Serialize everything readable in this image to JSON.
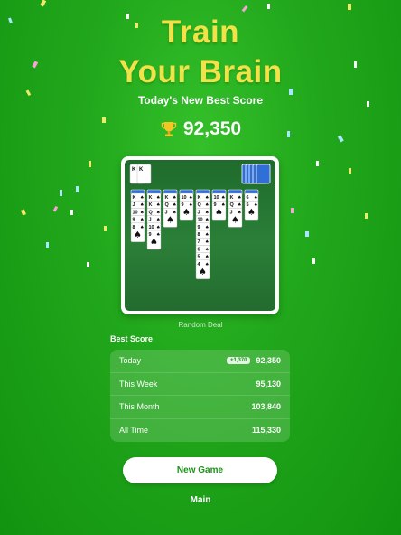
{
  "header": {
    "title_line1": "Train",
    "title_line2": "Your Brain",
    "subtitle": "Today's New Best Score",
    "score": "92,350",
    "trophy_icon": "trophy-icon"
  },
  "preview": {
    "caption": "Random Deal",
    "foundation": [
      "K",
      "K"
    ],
    "columns": [
      [
        "K",
        "J",
        "10",
        "9",
        "8"
      ],
      [
        "K",
        "K",
        "Q",
        "J",
        "10",
        "9"
      ],
      [
        "K",
        "Q",
        "J"
      ],
      [
        "10",
        "9"
      ],
      [
        "K",
        "Q",
        "J",
        "10",
        "9",
        "8",
        "7",
        "6",
        "5",
        "4"
      ],
      [
        "10",
        "9"
      ],
      [
        "K",
        "Q",
        "J"
      ],
      [
        "6",
        "5"
      ]
    ]
  },
  "best_score": {
    "label": "Best Score",
    "rows": [
      {
        "period": "Today",
        "delta": "+1,370",
        "value": "92,350"
      },
      {
        "period": "This Week",
        "delta": "",
        "value": "95,130"
      },
      {
        "period": "This Month",
        "delta": "",
        "value": "103,840"
      },
      {
        "period": "All Time",
        "delta": "",
        "value": "115,330"
      }
    ]
  },
  "actions": {
    "new_game": "New Game",
    "main": "Main"
  },
  "colors": {
    "background": "#22a81c",
    "title": "#f2e24a",
    "button_text": "#1c9218",
    "board": "#2b7f37",
    "card_back": "#2f6fd6"
  }
}
